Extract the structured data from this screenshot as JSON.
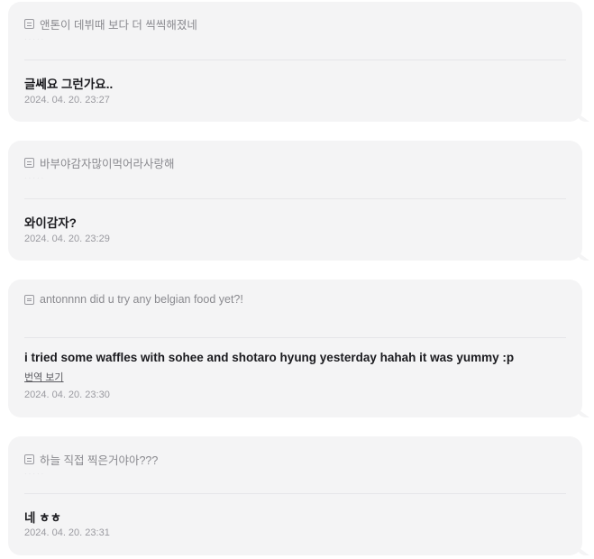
{
  "items": [
    {
      "question": "앤톤이 데뷔때 보다 더 씩씩해졌네",
      "answer": "글쎄요 그런가요..",
      "timestamp": "2024. 04. 20. 23:27"
    },
    {
      "question": "바부야감자많이먹어라사랑해",
      "answer": "와이감자?",
      "timestamp": "2024. 04. 20. 23:29"
    },
    {
      "question": "antonnnn did u try any belgian food yet?!",
      "answer": "i tried some waffles with sohee and shotaro hyung yesterday hahah it was yummy :p",
      "translate_label": "번역 보기",
      "timestamp": "2024. 04. 20. 23:30"
    },
    {
      "question": "하늘 직접 찍은거야아???",
      "answer": "네 ㅎㅎ",
      "timestamp": "2024. 04. 20. 23:31"
    }
  ],
  "icons": {
    "question": "question-box-icon"
  },
  "colors": {
    "card_background": "#f4f4f5",
    "question_text": "#8a8a8f",
    "answer_text": "#1b1b1f",
    "timestamp_text": "#9a9aa0"
  }
}
